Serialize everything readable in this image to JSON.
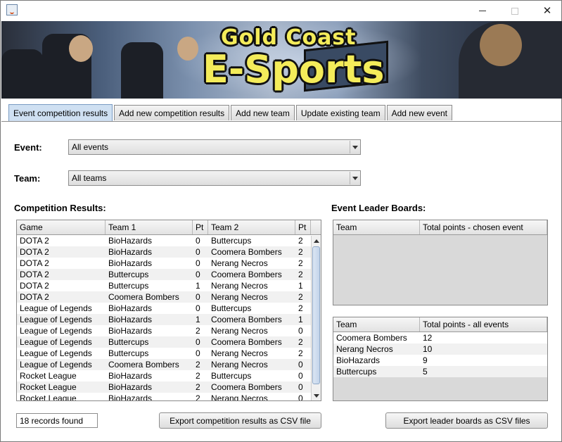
{
  "window": {
    "title": ""
  },
  "banner": {
    "line1": "Gold Coast",
    "line2": "E-Sports"
  },
  "tabs": [
    {
      "label": "Event competition results",
      "active": true
    },
    {
      "label": "Add new competition results",
      "active": false
    },
    {
      "label": "Add new team",
      "active": false
    },
    {
      "label": "Update existing team",
      "active": false
    },
    {
      "label": "Add new event",
      "active": false
    }
  ],
  "filters": {
    "event_label": "Event:",
    "event_value": "All events",
    "team_label": "Team:",
    "team_value": "All teams"
  },
  "results": {
    "heading": "Competition Results:",
    "columns": [
      "Game",
      "Team 1",
      "Pt",
      "Team 2",
      "Pt"
    ],
    "rows": [
      [
        "DOTA 2",
        "BioHazards",
        "0",
        "Buttercups",
        "2"
      ],
      [
        "DOTA 2",
        "BioHazards",
        "0",
        "Coomera Bombers",
        "2"
      ],
      [
        "DOTA 2",
        "BioHazards",
        "0",
        "Nerang Necros",
        "2"
      ],
      [
        "DOTA 2",
        "Buttercups",
        "0",
        "Coomera Bombers",
        "2"
      ],
      [
        "DOTA 2",
        "Buttercups",
        "1",
        "Nerang Necros",
        "1"
      ],
      [
        "DOTA 2",
        "Coomera Bombers",
        "0",
        "Nerang Necros",
        "2"
      ],
      [
        "League of Legends",
        "BioHazards",
        "0",
        "Buttercups",
        "2"
      ],
      [
        "League of Legends",
        "BioHazards",
        "1",
        "Coomera Bombers",
        "1"
      ],
      [
        "League of Legends",
        "BioHazards",
        "2",
        "Nerang Necros",
        "0"
      ],
      [
        "League of Legends",
        "Buttercups",
        "0",
        "Coomera Bombers",
        "2"
      ],
      [
        "League of Legends",
        "Buttercups",
        "0",
        "Nerang Necros",
        "2"
      ],
      [
        "League of Legends",
        "Coomera Bombers",
        "2",
        "Nerang Necros",
        "0"
      ],
      [
        "Rocket League",
        "BioHazards",
        "2",
        "Buttercups",
        "0"
      ],
      [
        "Rocket League",
        "BioHazards",
        "2",
        "Coomera Bombers",
        "0"
      ],
      [
        "Rocket League",
        "BioHazards",
        "2",
        "Nerang Necros",
        "0"
      ]
    ],
    "records_found": "18 records found",
    "export_label": "Export competition results as CSV file"
  },
  "leaderboards": {
    "heading": "Event Leader Boards:",
    "chosen_event": {
      "columns": [
        "Team",
        "Total points - chosen event"
      ],
      "rows": []
    },
    "all_events": {
      "columns": [
        "Team",
        "Total points - all events"
      ],
      "rows": [
        [
          "Coomera Bombers",
          "12"
        ],
        [
          "Nerang Necros",
          "10"
        ],
        [
          "BioHazards",
          "9"
        ],
        [
          "Buttercups",
          "5"
        ]
      ]
    },
    "export_label": "Export leader boards as CSV files"
  },
  "colors": {
    "active_tab": "#cfe0f2",
    "banner_text": "#f4ec5a"
  }
}
